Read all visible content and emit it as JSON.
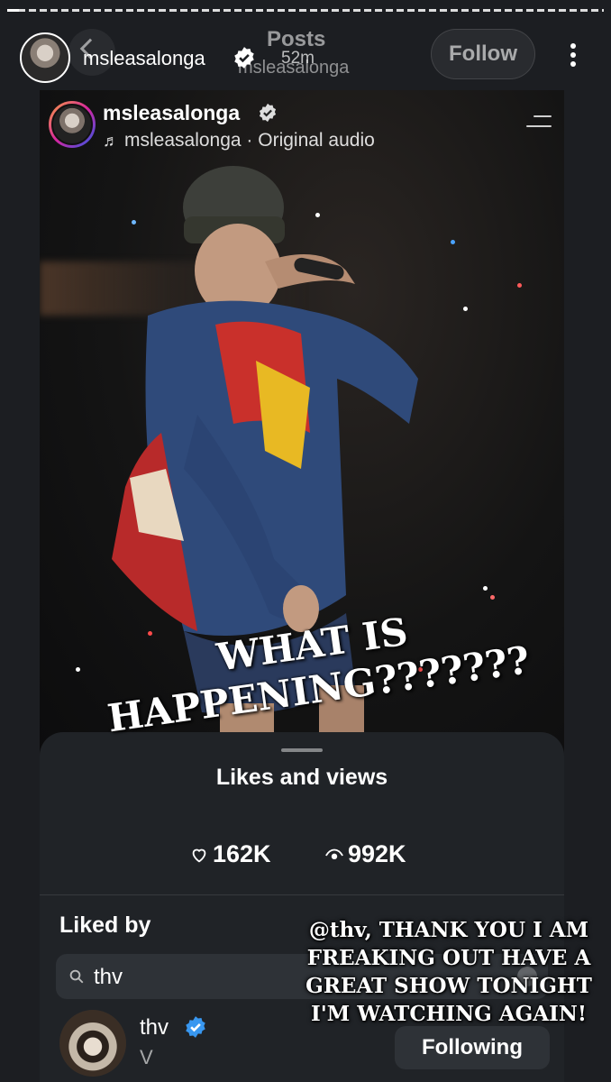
{
  "story": {
    "progress": 0.02,
    "username": "msleasalonga",
    "time": "52m",
    "colors": {
      "background": "#1c1e22",
      "sheet": "#202327",
      "verified_blue": "#3897f0"
    }
  },
  "ghost_header": {
    "title": "Posts",
    "subtitle": "msleasalonga",
    "follow_label": "Follow"
  },
  "post": {
    "username": "msleasalonga",
    "audio": "msleasalonga · Original audio"
  },
  "sticker_text": "WHAT IS HAPPENING???????",
  "sheet": {
    "title": "Likes and views",
    "likes": "162K",
    "views": "992K",
    "liked_by_label": "Liked by",
    "search_value": "thv",
    "user": {
      "name": "thv",
      "subtitle": "V",
      "button_label": "Following"
    }
  },
  "caption": "@thv, THANK YOU I AM FREAKING OUT HAVE A GREAT SHOW TONIGHT I'M WATCHING AGAIN!"
}
